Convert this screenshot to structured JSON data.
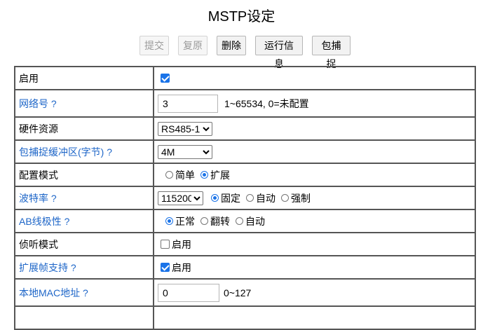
{
  "page": {
    "title": "MSTP设定"
  },
  "toolbar": {
    "submit_label": "提交",
    "restore_label": "复原",
    "delete_label": "删除",
    "runinfo_label": "运行信息",
    "capture_label": "包捕捉"
  },
  "rows": {
    "enable": {
      "label": "启用",
      "checked": true
    },
    "network": {
      "label": "网络号 ?",
      "value": "3",
      "hint": "1~65534, 0=未配置"
    },
    "hardware": {
      "label": "硬件资源",
      "selected": "RS485-1"
    },
    "capture_buffer": {
      "label": "包捕捉缓冲区(字节) ?",
      "selected": "4M"
    },
    "config_mode": {
      "label": "配置模式",
      "opt1": "简单",
      "opt2": "扩展",
      "selected": "扩展"
    },
    "baud": {
      "label": "波特率 ?",
      "selected": "115200",
      "opt1": "固定",
      "opt2": "自动",
      "opt3": "强制",
      "mode_selected": "固定"
    },
    "ab_polarity": {
      "label": "AB线极性 ?",
      "opt1": "正常",
      "opt2": "翻转",
      "opt3": "自动",
      "selected": "正常"
    },
    "listen_mode": {
      "label": "侦听模式",
      "check_label": "启用",
      "checked": false
    },
    "ext_frame": {
      "label": "扩展帧支持 ?",
      "check_label": "启用",
      "checked": true
    },
    "mac": {
      "label": "本地MAC地址 ?",
      "value": "0",
      "hint": "0~127"
    }
  },
  "colors": {
    "link": "#1e66c8",
    "accent": "#1a73e8",
    "border": "#555555"
  }
}
